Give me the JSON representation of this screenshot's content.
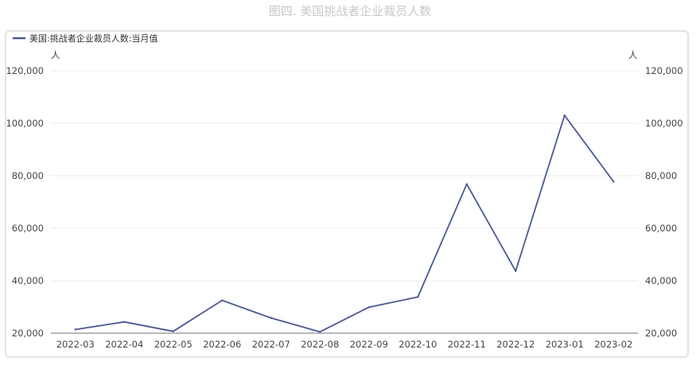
{
  "title": "图四. 美国挑战者企业裁员人数",
  "chart_data": {
    "type": "line",
    "title": "图四. 美国挑战者企业裁员人数",
    "x": [
      "2022-03",
      "2022-04",
      "2022-05",
      "2022-06",
      "2022-07",
      "2022-08",
      "2022-09",
      "2022-10",
      "2022-11",
      "2022-12",
      "2023-01",
      "2023-02"
    ],
    "series": [
      {
        "name": "美国:挑战者企业裁员人数:当月值",
        "values": [
          21400,
          24300,
          20700,
          32500,
          25800,
          20500,
          29900,
          33800,
          76800,
          43700,
          103000,
          77800
        ],
        "color": "#4a5894"
      }
    ],
    "yleft_unit": "人",
    "yright_unit": "人",
    "ylim": [
      20000,
      120000
    ],
    "yticks": [
      20000,
      40000,
      60000,
      80000,
      100000,
      120000
    ],
    "ytick_labels": [
      "20,000",
      "40,000",
      "60,000",
      "80,000",
      "100,000",
      "120,000"
    ],
    "grid": true,
    "legend": "top-left"
  }
}
